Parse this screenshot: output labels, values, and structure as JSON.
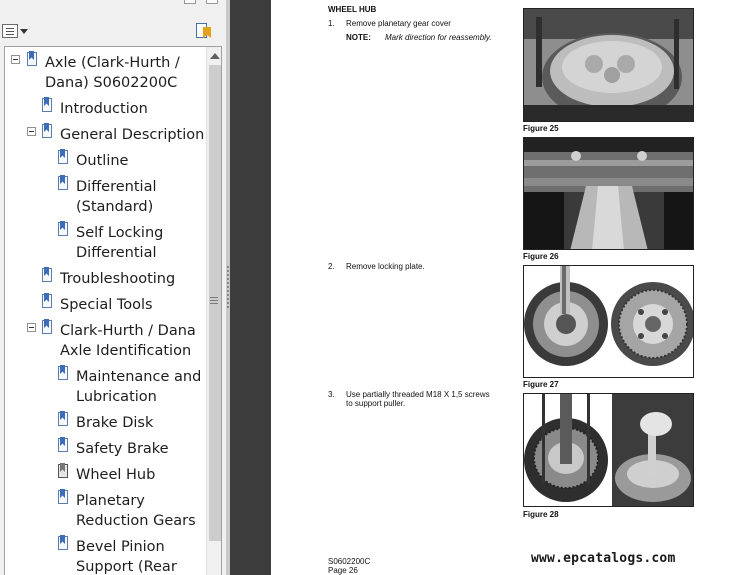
{
  "bookmarks": {
    "tree": {
      "root": {
        "label_line1": "Axle (Clark-Hurth /",
        "label_line2": "Dana) S0602200C"
      },
      "introduction": "Introduction",
      "general_description": "General Description",
      "outline": "Outline",
      "differential": {
        "line1": "Differential",
        "line2": "(Standard)"
      },
      "self_locking": {
        "line1": "Self Locking",
        "line2": "Differential"
      },
      "troubleshooting": "Troubleshooting",
      "special_tools": "Special Tools",
      "identification": {
        "line1": "Clark-Hurth / Dana",
        "line2": "Axle Identification"
      },
      "maintenance": {
        "line1": "Maintenance and",
        "line2": "Lubrication"
      },
      "brake_disk": "Brake Disk",
      "safety_brake": "Safety Brake",
      "wheel_hub": "Wheel Hub",
      "planetary": {
        "line1": "Planetary",
        "line2": "Reduction Gears"
      },
      "bevel_pinion": {
        "line1": "Bevel Pinion",
        "line2": "Support (Rear"
      }
    }
  },
  "document": {
    "section_title": "WHEEL HUB",
    "steps": [
      {
        "num": "1.",
        "text": "Remove planetary gear cover"
      },
      {
        "num": "2.",
        "text": "Remove locking plate."
      },
      {
        "num": "3.",
        "text_line1": "Use  partially  threaded  M18 X 1,5  screws",
        "text_line2": "to support puller."
      }
    ],
    "note": {
      "label": "NOTE:",
      "text": "Mark direction for reassembly."
    },
    "figures": [
      "Figure 25",
      "Figure 26",
      "Figure 27",
      "Figure 28"
    ],
    "footer": {
      "code": "S0602200C",
      "page": "Page 26"
    },
    "watermark": "www.epcatalogs.com"
  },
  "colors": {
    "gutter": "#3c3c3c",
    "bookmark_blue": "#3f6db5",
    "panel": "#f0f0f0"
  },
  "icons": [
    "options-menu-icon",
    "expand-bookmark-icon",
    "bookmark-icon",
    "collapse-toggle-icon",
    "scroll-up-arrow-icon",
    "scroll-grip-icon"
  ]
}
